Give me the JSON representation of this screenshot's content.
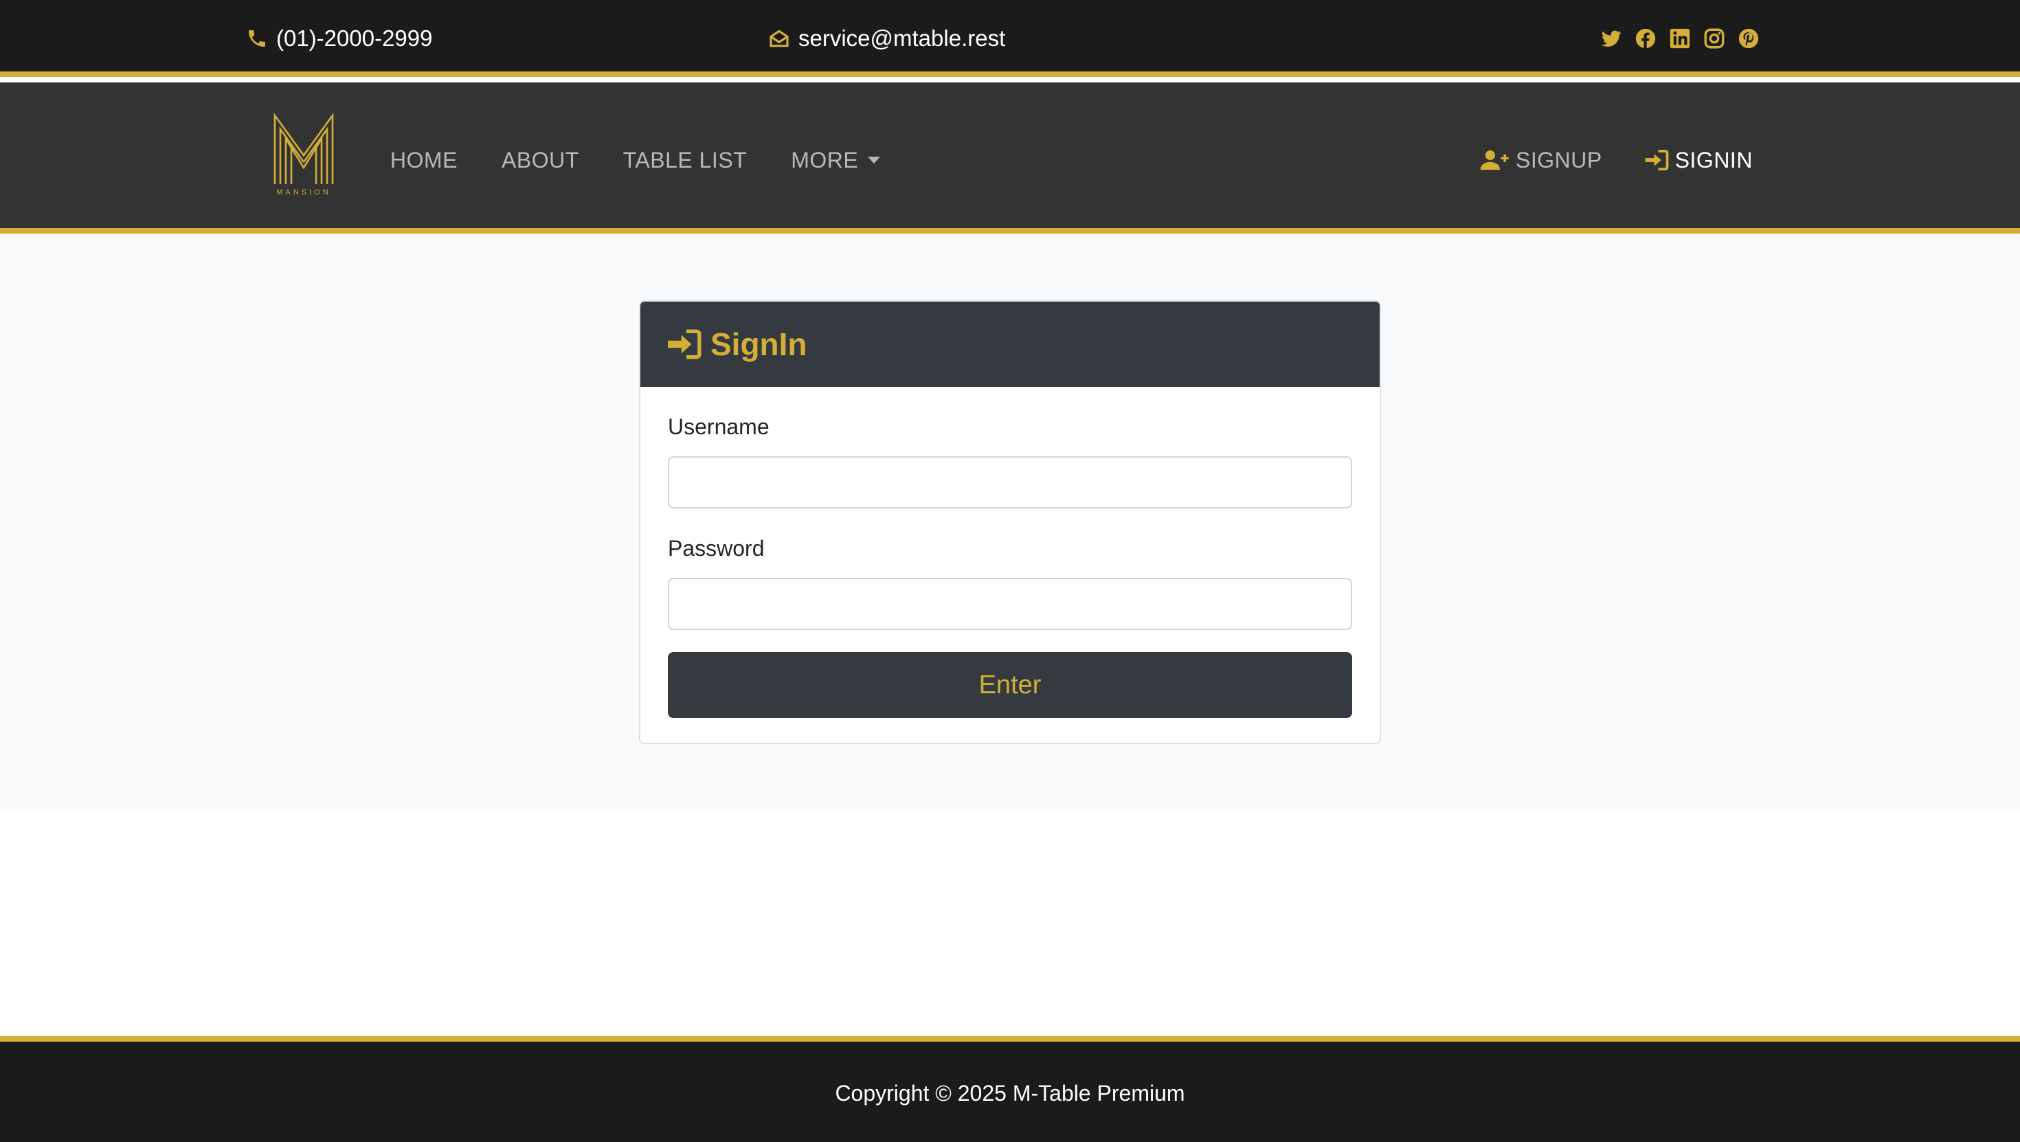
{
  "colors": {
    "accent": "#d4af37",
    "topbar_bg": "#1b1b1b",
    "navbar_bg": "#333333",
    "card_header_bg": "#343a40",
    "main_bg": "#f8f9fa"
  },
  "topbar": {
    "phone": {
      "icon": "phone-icon",
      "text": "(01)-2000-2999"
    },
    "email": {
      "icon": "envelope-open-icon",
      "text": "service@mtable.rest"
    },
    "socials": [
      "twitter-icon",
      "facebook-icon",
      "linkedin-icon",
      "instagram-icon",
      "pinterest-icon"
    ]
  },
  "navbar": {
    "logo": {
      "letter": "M",
      "wordmark": "MANSION"
    },
    "links": [
      {
        "label": "HOME"
      },
      {
        "label": "ABOUT"
      },
      {
        "label": "TABLE LIST"
      },
      {
        "label": "MORE"
      }
    ],
    "signup": {
      "label": "SIGNUP",
      "icon": "user-plus-icon"
    },
    "signin": {
      "label": "SIGNIN",
      "icon": "sign-in-icon"
    }
  },
  "signin_card": {
    "title": "SignIn",
    "icon": "sign-in-icon",
    "username_label": "Username",
    "username_value": "",
    "password_label": "Password",
    "password_value": "",
    "submit_label": "Enter"
  },
  "footer": {
    "copyright": "Copyright © 2025 M-Table Premium"
  }
}
